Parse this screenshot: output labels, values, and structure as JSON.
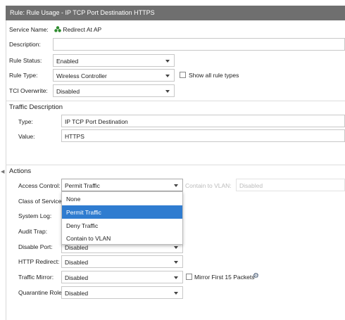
{
  "window": {
    "title": "Rule: Rule Usage - IP TCP Port Destination HTTPS"
  },
  "form": {
    "service_name": {
      "label": "Service Name:",
      "value": "Redirect At AP"
    },
    "description": {
      "label": "Description:",
      "value": ""
    },
    "rule_status": {
      "label": "Rule Status:",
      "value": "Enabled"
    },
    "rule_type": {
      "label": "Rule Type:",
      "value": "Wireless Controller",
      "checkbox_label": "Show all rule types"
    },
    "tci_overwrite": {
      "label": "TCI Overwrite:",
      "value": "Disabled"
    }
  },
  "traffic": {
    "heading": "Traffic Description",
    "type": {
      "label": "Type:",
      "value": "IP TCP Port Destination"
    },
    "value": {
      "label": "Value:",
      "value": "HTTPS"
    }
  },
  "actions": {
    "heading": "Actions",
    "access_control": {
      "label": "Access Control:",
      "value": "Permit Traffic"
    },
    "contain_to_vlan": {
      "label": "Contain to VLAN:",
      "value": "Disabled"
    },
    "class_of_service": {
      "label": "Class of Service:"
    },
    "system_log": {
      "label": "System Log:"
    },
    "audit_trap": {
      "label": "Audit Trap:"
    },
    "disable_port": {
      "label": "Disable Port:",
      "value": "Disabled"
    },
    "http_redirect": {
      "label": "HTTP Redirect:",
      "value": "Disabled"
    },
    "traffic_mirror": {
      "label": "Traffic Mirror:",
      "value": "Disabled",
      "checkbox_label": "Mirror First 15 Packets"
    },
    "quarantine_role": {
      "label": "Quarantine Role:",
      "value": "Disabled"
    }
  },
  "access_dropdown": {
    "options": [
      "None",
      "Permit Traffic",
      "Deny Traffic",
      "Contain to VLAN"
    ],
    "selected": "Permit Traffic"
  },
  "colors": {
    "titlebar": "#6f6f6f",
    "selection": "#2f7cd0",
    "service_icon": "#2e8b2e"
  }
}
